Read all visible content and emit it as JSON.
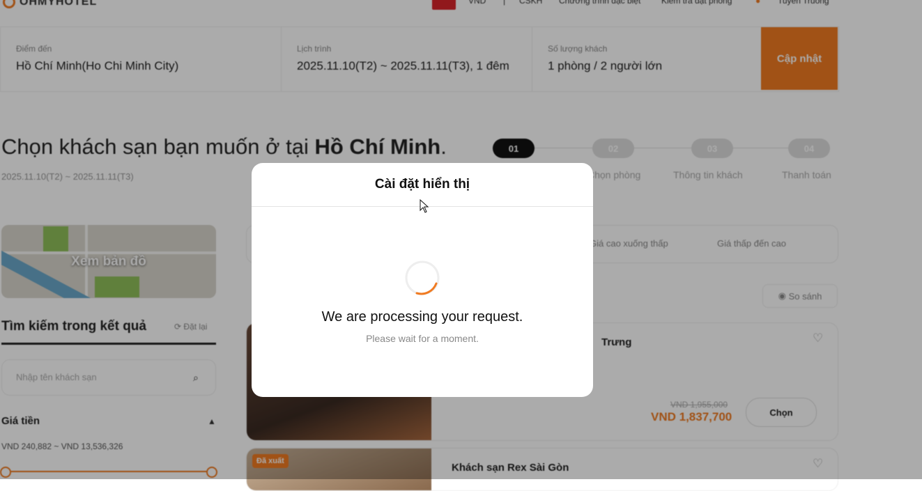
{
  "header": {
    "logo_text": "OHMYHOTEL",
    "currency": "VND",
    "nav_items": [
      "CSKH",
      "Chương trình đặc biệt",
      "Kiểm tra đặt phòng"
    ],
    "user_name": "Tuyen Truong"
  },
  "search_bar": {
    "destination_label": "Điểm đến",
    "destination_value": "Hồ Chí Minh(Ho Chi Minh City)",
    "schedule_label": "Lịch trình",
    "schedule_value": "2025.11.10(T2) ~ 2025.11.11(T3), 1 đêm",
    "guests_label": "Số lượng khách",
    "guests_value": "1 phòng / 2 người lớn",
    "update_button": "Cập nhật"
  },
  "page_title": {
    "prefix": "Chọn khách sạn bạn muốn ở tại ",
    "city": "Hồ Chí Minh",
    "suffix": ".",
    "dates": "2025.11.10(T2) ~ 2025.11.11(T3)"
  },
  "steps": [
    {
      "number": "01",
      "label": ""
    },
    {
      "number": "02",
      "label": "Chọn phòng"
    },
    {
      "number": "03",
      "label": "Thông tin khách"
    },
    {
      "number": "04",
      "label": "Thanh toán"
    }
  ],
  "sidebar": {
    "map_label": "Xem bản đồ",
    "filter_title": "Tìm kiếm trong kết quả",
    "reset_label": "Đặt lại",
    "hotel_search_placeholder": "Nhập tên khách sạn",
    "price_title": "Giá tiền",
    "price_range": "VND 240,882 ~ VND 13,536,326"
  },
  "sort": {
    "options": [
      "Giá cao xuống thấp",
      "Giá thấp đến cao"
    ],
    "compare_label": "So sánh"
  },
  "hotels": [
    {
      "name": "Trưng",
      "old_price": "VND 1,955,000",
      "price": "VND 1,837,700",
      "choose_label": "Chọn"
    },
    {
      "name": "Khách sạn Rex Sài Gòn",
      "badge": "Đã xuất"
    }
  ],
  "modal": {
    "title": "Cài đặt hiển thị",
    "message": "We are processing your request.",
    "submessage": "Please wait for a moment."
  },
  "colors": {
    "accent": "#f07b22",
    "overlay": "rgba(0,0,0,0.33)"
  }
}
